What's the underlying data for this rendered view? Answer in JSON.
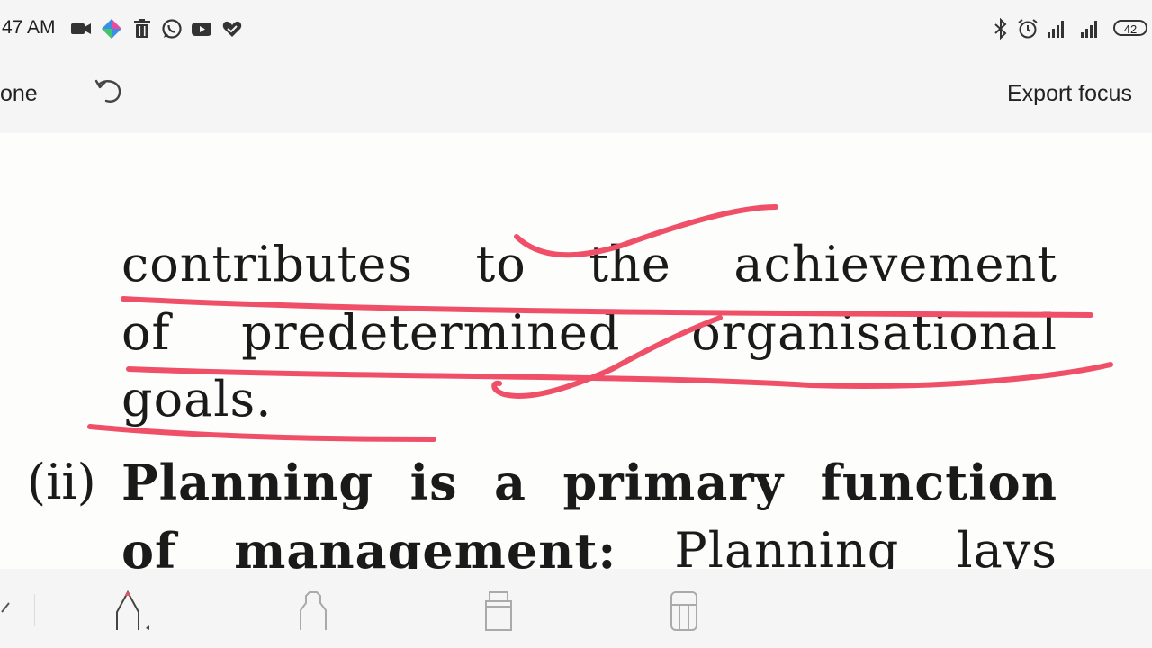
{
  "status_bar": {
    "time": "47 AM",
    "battery": "42"
  },
  "toolbar": {
    "done_label": "one",
    "export_label": "Export focus"
  },
  "document": {
    "lines": [
      [
        "contributes",
        "to",
        "the",
        "achievement"
      ],
      [
        "of",
        "predetermined",
        "organisational"
      ],
      [
        "goals."
      ]
    ],
    "item_number": "(ii)",
    "heading_line": [
      "Planning",
      "is",
      "a",
      "primary",
      "function"
    ],
    "cut_line": [
      "of",
      "management:",
      "Planning",
      "lays"
    ]
  },
  "colors": {
    "ink": "#ef5068",
    "toolbar_bg": "#f5f5f5",
    "page_bg": "#fdfdfc"
  },
  "tools": [
    "pen-tool",
    "marker-tool",
    "highlighter-tool",
    "eraser-tool"
  ]
}
